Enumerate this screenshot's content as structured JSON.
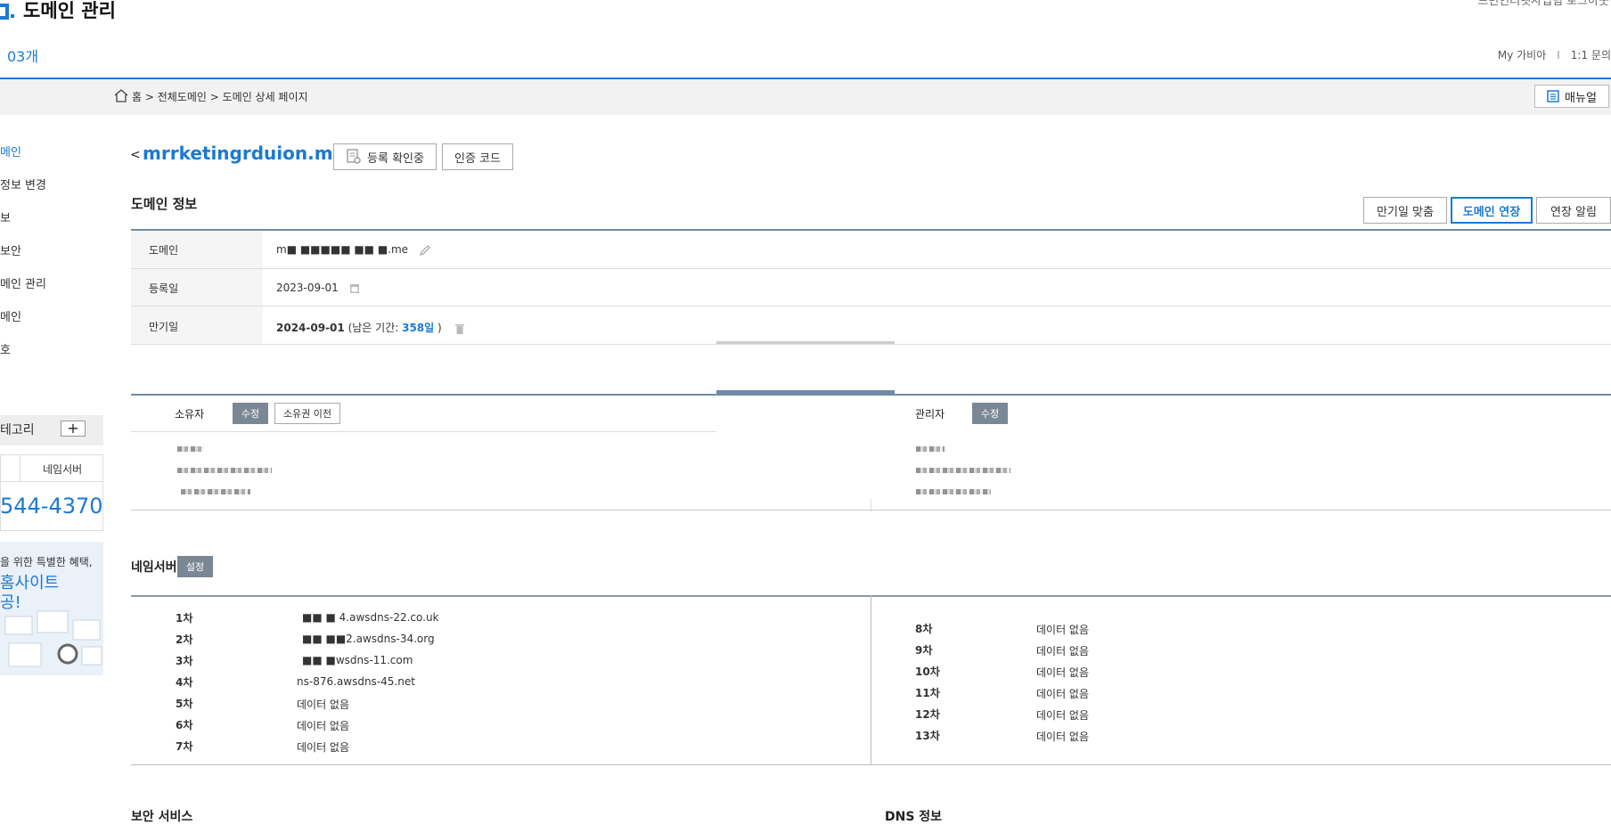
{
  "header": {
    "title": "도메인 관리",
    "top_right": "드민인터넷사업팀  로그아웃",
    "count": "03개",
    "links": [
      "My 가비아",
      "1:1 문의"
    ]
  },
  "breadcrumb": "홈 > 전체도메인 > 도메인 상세 페이지",
  "manual_button": "매뉴얼",
  "sidebar": {
    "items": [
      "메인",
      "정보 변경",
      "보",
      "보안",
      "메인 관리",
      "메인",
      "호"
    ],
    "category_label": "테고리",
    "category_add": "+",
    "ns_box_label": "네임서버",
    "phone": "544-4370",
    "promo_line1": "을 위한 특별한 혜택,",
    "promo_line2": "홈사이트",
    "promo_line3": "공!"
  },
  "domain": {
    "back": "<",
    "name": "mrrketi­ngrd­ui­on.me",
    "reg_status_button": "등록 확인중",
    "auth_code_button": "인증 코드"
  },
  "info": {
    "section_title": "도메인 정보",
    "expiry_match_button": "만기일 맞춤",
    "renew_button": "도메인 연장",
    "renew_alarm_button": "연장 알림",
    "domain_label": "도메인",
    "domain_value": "m■ ■■■■■ ■■ ■.me",
    "reg_label": "등록일",
    "reg_value": "2023-09-01",
    "exp_label": "만기일",
    "exp_value": "2024-09-01",
    "remain_prefix": " (남은 기간: ",
    "remain_days": "358일",
    "remain_suffix": " )"
  },
  "contacts": {
    "owner_label": "소유자",
    "owner_edit": "수정",
    "owner_transfer": "소유권 이전",
    "manager_label": "관리자",
    "manager_edit": "수정"
  },
  "nameservers": {
    "title": "네임서버",
    "set_button": "설정",
    "left": [
      {
        "label": "1차",
        "value": "■■ ■ 4.awsdns-22.co.uk"
      },
      {
        "label": "2차",
        "value": "■■ ■■2.awsdns-34.org"
      },
      {
        "label": "3차",
        "value": "■■ ■wsdns-11.com"
      },
      {
        "label": "4차",
        "value": "ns-876.awsdns-45.net"
      },
      {
        "label": "5차",
        "value": "데이터 없음"
      },
      {
        "label": "6차",
        "value": "데이터 없음"
      },
      {
        "label": "7차",
        "value": "데이터 없음"
      }
    ],
    "right": [
      {
        "label": "8차",
        "value": "데이터 없음"
      },
      {
        "label": "9차",
        "value": "데이터 없음"
      },
      {
        "label": "10차",
        "value": "데이터 없음"
      },
      {
        "label": "11차",
        "value": "데이터 없음"
      },
      {
        "label": "12차",
        "value": "데이터 없음"
      },
      {
        "label": "13차",
        "value": "데이터 없음"
      }
    ]
  },
  "bottom": {
    "security_title": "보안 서비스",
    "dns_title": "DNS 정보"
  }
}
